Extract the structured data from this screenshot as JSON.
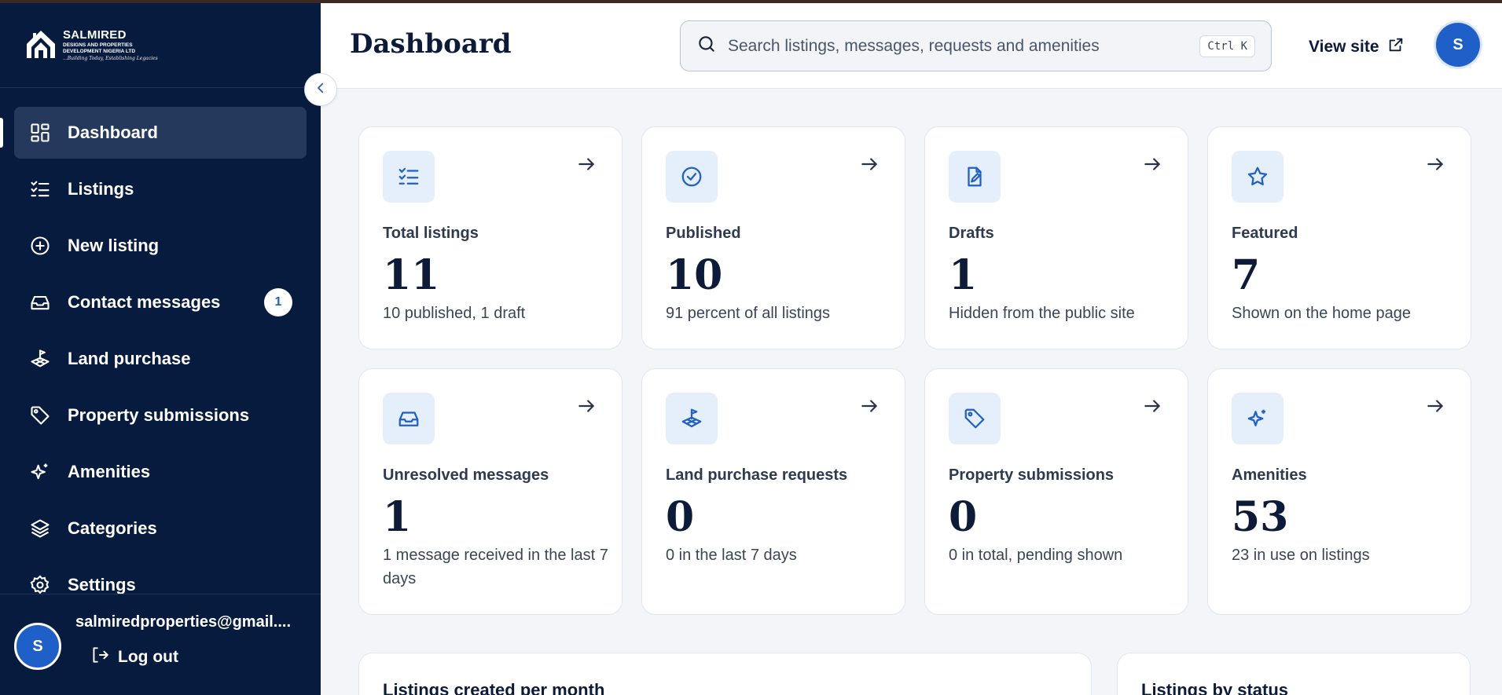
{
  "brand": {
    "name": "SALMIRED",
    "subtitle": "DESIGNS AND PROPERTIES DEVELOPMENT NIGERIA LTD",
    "tagline": "...Building Today, Establishing Legacies"
  },
  "sidebar": {
    "items": [
      {
        "label": "Dashboard",
        "icon": "grid-icon",
        "active": true
      },
      {
        "label": "Listings",
        "icon": "checklist-icon"
      },
      {
        "label": "New listing",
        "icon": "plus-circle-icon"
      },
      {
        "label": "Contact messages",
        "icon": "inbox-icon",
        "badge": "1"
      },
      {
        "label": "Land purchase",
        "icon": "land-plot-icon"
      },
      {
        "label": "Property submissions",
        "icon": "tag-icon"
      },
      {
        "label": "Amenities",
        "icon": "sparkles-icon"
      },
      {
        "label": "Categories",
        "icon": "layers-icon"
      },
      {
        "label": "Settings",
        "icon": "gear-icon"
      }
    ],
    "user": {
      "initial": "S",
      "email": "salmiredproperties@gmail....",
      "logout_label": "Log out"
    }
  },
  "header": {
    "title": "Dashboard",
    "search_placeholder": "Search listings, messages, requests and amenities",
    "shortcut": "Ctrl K",
    "view_site_label": "View site",
    "avatar_initial": "S"
  },
  "stats": [
    {
      "label": "Total listings",
      "value": "11",
      "sub": "10 published, 1 draft",
      "icon": "checklist-icon"
    },
    {
      "label": "Published",
      "value": "10",
      "sub": "91 percent of all listings",
      "icon": "check-circle-icon"
    },
    {
      "label": "Drafts",
      "value": "1",
      "sub": "Hidden from the public site",
      "icon": "file-edit-icon"
    },
    {
      "label": "Featured",
      "value": "7",
      "sub": "Shown on the home page",
      "icon": "star-icon"
    },
    {
      "label": "Unresolved messages",
      "value": "1",
      "sub": "1 message received in the last 7 days",
      "icon": "inbox-icon"
    },
    {
      "label": "Land purchase requests",
      "value": "0",
      "sub": "0 in the last 7 days",
      "icon": "land-plot-icon"
    },
    {
      "label": "Property submissions",
      "value": "0",
      "sub": "0 in total, pending shown",
      "icon": "tag-icon"
    },
    {
      "label": "Amenities",
      "value": "53",
      "sub": "23 in use on listings",
      "icon": "sparkles-icon"
    }
  ],
  "panels": {
    "listings_per_month_title": "Listings created per month",
    "listings_by_status_title": "Listings by status"
  },
  "colors": {
    "sidebar_bg": "#071b3f",
    "accent": "#1f5fc8",
    "page_bg": "#f3f5f9"
  }
}
